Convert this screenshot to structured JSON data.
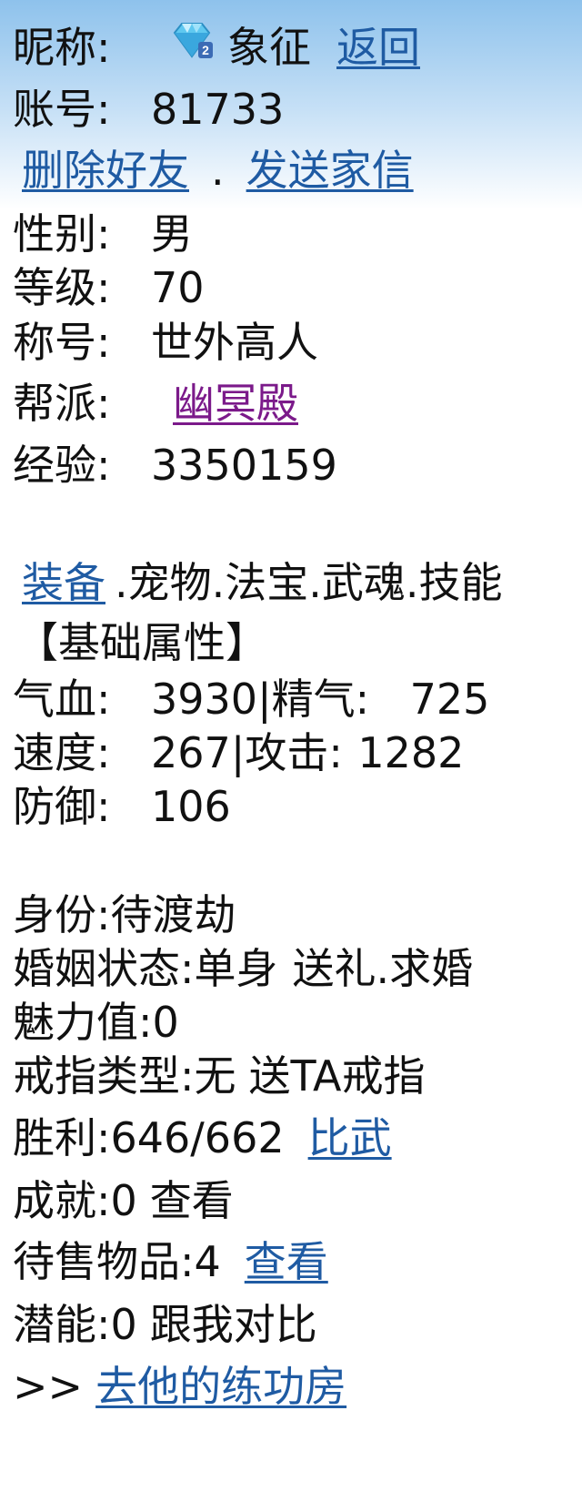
{
  "profile": {
    "nickname_label": "昵称:",
    "nickname": "象征",
    "back_link": "返回",
    "account_label": "账号:",
    "account": "81733",
    "delete_friend": "删除好友",
    "separator": ".",
    "send_letter": "发送家信",
    "gender_label": "性别:",
    "gender": "男",
    "level_label": "等级:",
    "level": "70",
    "title_label": "称号:",
    "title": "世外高人",
    "guild_label": "帮派:",
    "guild": "幽冥殿",
    "exp_label": "经验:",
    "exp": "3350159"
  },
  "tabs": {
    "equipment": "装备",
    "rest": ".宠物.法宝.武魂.技能"
  },
  "attributes": {
    "header": "【基础属性】",
    "row1": {
      "hp_label": "气血:",
      "hp": "3930",
      "sep": "|",
      "mp_label": "精气:",
      "mp": "725"
    },
    "row2": {
      "speed_label": "速度:",
      "speed": "267",
      "sep": "|",
      "atk_label": "攻击:",
      "atk": "1282"
    },
    "row3": {
      "def_label": "防御:",
      "def": "106"
    }
  },
  "status": {
    "identity": "身份:待渡劫",
    "marriage": "婚姻状态:单身",
    "marriage_actions": "送礼.求婚",
    "charm": "魅力值:0",
    "ring": "戒指类型:无",
    "ring_action": "送TA戒指",
    "wins": "胜利:646/662",
    "duel": "比武",
    "achievements": "成就:0",
    "achievements_view": "查看",
    "items_for_sale": "待售物品:4",
    "items_view": "查看",
    "potential": "潜能:0",
    "compare": "跟我对比",
    "prefix": ">>",
    "training_room": "去他的练功房"
  },
  "icons": {
    "gem": "diamond-badge-icon"
  }
}
